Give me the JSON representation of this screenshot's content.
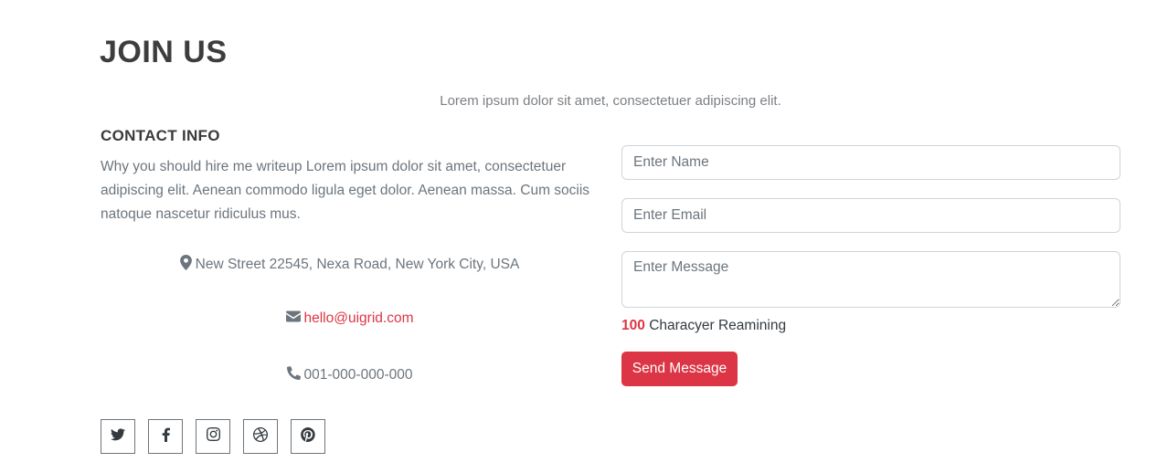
{
  "section": {
    "title": "JOIN US",
    "subtitle": "Lorem ipsum dolor sit amet, consectetuer adipiscing elit."
  },
  "contact": {
    "heading": "CONTACT INFO",
    "text": "Why you should hire me writeup Lorem ipsum dolor sit amet, consectetuer adipiscing elit. Aenean commodo ligula eget dolor. Aenean massa. Cum sociis natoque nascetur ridiculus mus.",
    "address": "New Street 22545, Nexa Road, New York City, USA",
    "email": "hello@uigrid.com",
    "phone": "001-000-000-000",
    "icons": [
      "map-marker-icon",
      "envelope-icon",
      "phone-icon"
    ]
  },
  "socials": [
    {
      "name": "twitter",
      "icon": "twitter-icon"
    },
    {
      "name": "facebook",
      "icon": "facebook-icon"
    },
    {
      "name": "instagram",
      "icon": "instagram-icon"
    },
    {
      "name": "dribbble",
      "icon": "dribbble-icon"
    },
    {
      "name": "pinterest",
      "icon": "pinterest-icon"
    }
  ],
  "form": {
    "name_placeholder": "Enter Name",
    "email_placeholder": "Enter Email",
    "message_placeholder": "Enter Message",
    "counter_value": "100",
    "counter_label": "Characyer Reamining",
    "submit_label": "Send Message"
  },
  "colors": {
    "accent": "#dc3545",
    "heading": "#3d3d3d",
    "text": "#6c757d"
  }
}
